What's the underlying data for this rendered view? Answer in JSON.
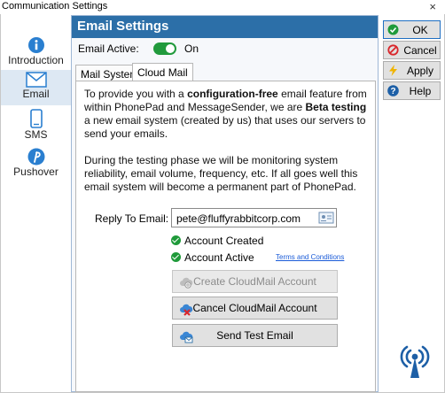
{
  "window": {
    "title": "Communication Settings",
    "close_glyph": "×"
  },
  "sidebar": {
    "items": [
      {
        "label": "Introduction",
        "icon": "info-icon",
        "active": false
      },
      {
        "label": "Email",
        "icon": "envelope-icon",
        "active": true
      },
      {
        "label": "SMS",
        "icon": "phone-icon",
        "active": false
      },
      {
        "label": "Pushover",
        "icon": "pushover-icon",
        "active": false
      }
    ]
  },
  "header": {
    "title": "Email Settings",
    "color": "#2c6fa8"
  },
  "email_active": {
    "label": "Email Active:",
    "state_text": "On",
    "enabled": true
  },
  "tabs": [
    {
      "label": "Mail System",
      "selected": false
    },
    {
      "label": "Cloud Mail",
      "selected": true
    }
  ],
  "intro": {
    "p1_a": "To provide you with a ",
    "p1_b": "configuration-free",
    "p1_c": " email feature from within PhonePad and MessageSender, we are ",
    "p1_d": "Beta testing",
    "p1_e": " a new email system (created by us) that uses our servers to send your emails.",
    "p2": "During the testing phase we will be monitoring system reliability, email volume, frequency, etc.  If all goes well this email system will become a permanent part of PhonePad."
  },
  "reply": {
    "label": "Reply To Email:",
    "value": "pete@fluffyrabbitcorp.com"
  },
  "status": {
    "created": "Account Created",
    "active": "Account Active",
    "terms_link": "Terms and Conditions"
  },
  "actions": {
    "create": "Create CloudMail Account",
    "cancel": "Cancel CloudMail Account",
    "test": "Send Test Email"
  },
  "buttons": {
    "ok": "OK",
    "cancel": "Cancel",
    "apply": "Apply",
    "help": "Help"
  },
  "colors": {
    "accent": "#2c6fa8",
    "success": "#1f9a3a",
    "danger": "#d9262b",
    "link": "#1a5bd8"
  }
}
